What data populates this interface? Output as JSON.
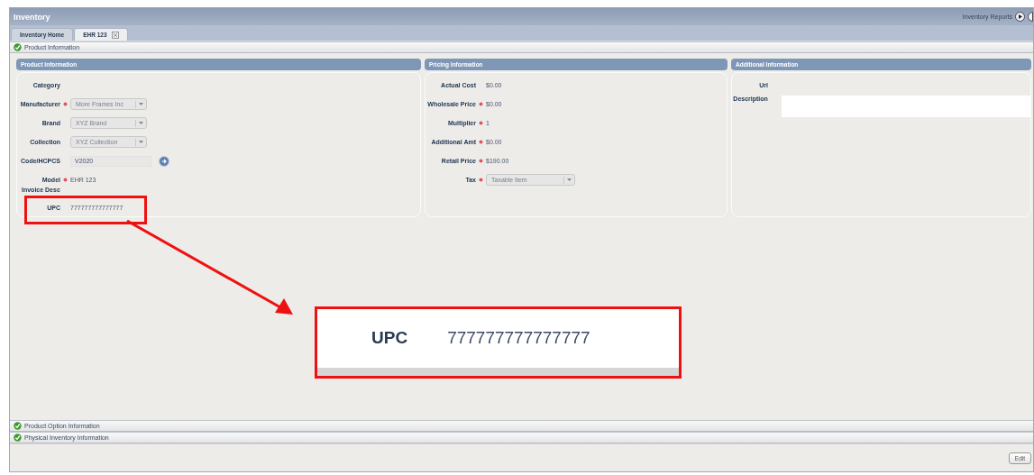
{
  "window": {
    "title": "Inventory",
    "reports_link": "Inventory Reports"
  },
  "tabs": [
    {
      "label": "Inventory Home",
      "selected": false
    },
    {
      "label": "EHR 123",
      "selected": true
    }
  ],
  "sections_top": [
    {
      "label": "Product Information",
      "checked": true
    }
  ],
  "panels": [
    {
      "title": "Product Information",
      "fields": [
        {
          "label": "Category",
          "kind": "text",
          "required": false
        },
        {
          "label": "Manufacturer",
          "kind": "select",
          "required": true,
          "value": "More Frames Inc"
        },
        {
          "label": "Brand",
          "kind": "select",
          "required": false,
          "value": "XYZ Brand"
        },
        {
          "label": "Collection",
          "kind": "select",
          "required": false,
          "value": "XYZ Collection"
        },
        {
          "label": "Code/HCPCS",
          "kind": "lookup",
          "required": false,
          "value": "V2020"
        },
        {
          "label": "Model",
          "kind": "text",
          "required": true,
          "value": "EHR 123"
        },
        {
          "label": "Invoice Desc",
          "kind": "heading",
          "required": false
        },
        {
          "label": "UPC",
          "kind": "text",
          "required": false,
          "value": "777777777777777"
        }
      ]
    },
    {
      "title": "Pricing Information",
      "fields": [
        {
          "label": "Actual Cost",
          "kind": "text",
          "required": false,
          "value": "$0.00"
        },
        {
          "label": "Wholesale Price",
          "kind": "text",
          "required": true,
          "value": "$0.00"
        },
        {
          "label": "Multiplier",
          "kind": "text",
          "required": true,
          "value": "1"
        },
        {
          "label": "Additional Amt",
          "kind": "text",
          "required": true,
          "value": "$0.00"
        },
        {
          "label": "Retail Price",
          "kind": "text",
          "required": true,
          "value": "$190.00"
        },
        {
          "label": "Tax",
          "kind": "select",
          "required": true,
          "value": "Taxable Item"
        }
      ]
    },
    {
      "title": "Additional Information",
      "fields": [
        {
          "label": "Url",
          "kind": "text",
          "required": false
        },
        {
          "label": "Description",
          "kind": "textarea",
          "required": false
        }
      ]
    }
  ],
  "sections_bottom": [
    {
      "label": "Product Option Information",
      "checked": true
    },
    {
      "label": "Physical Inventory Information",
      "checked": true
    }
  ],
  "footer": {
    "button": "Edit"
  },
  "callout": {
    "label": "UPC",
    "value": "777777777777777"
  }
}
